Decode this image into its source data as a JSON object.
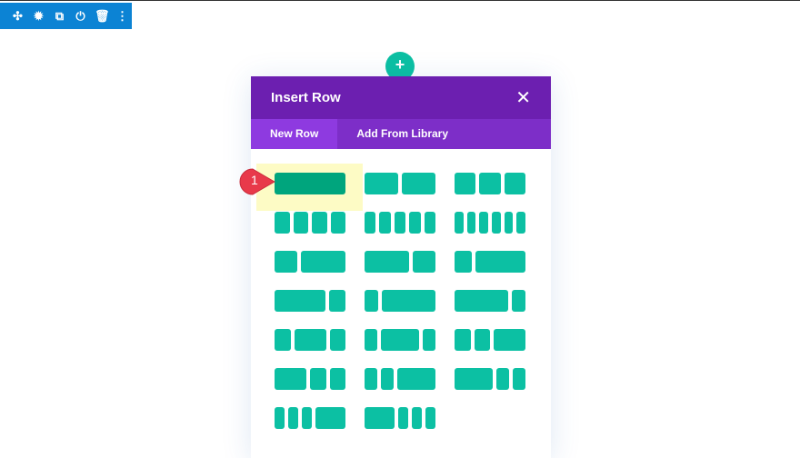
{
  "toolbar": {
    "icons": [
      "move-icon",
      "gear-icon",
      "duplicate-icon",
      "power-icon",
      "trash-icon",
      "more-icon"
    ],
    "glyphs": [
      "✣",
      "✹",
      "⧉",
      "⏻",
      "🗑",
      "⋮"
    ]
  },
  "add_button": {
    "glyph": "+"
  },
  "modal": {
    "title": "Insert Row",
    "close": "✕",
    "tabs": [
      {
        "label": "New Row",
        "active": true
      },
      {
        "label": "Add From Library",
        "active": false
      }
    ]
  },
  "layouts": [
    [
      1
    ],
    [
      1,
      1
    ],
    [
      1,
      1,
      1
    ],
    [
      1,
      1,
      1,
      1
    ],
    [
      1,
      1,
      1,
      1,
      1
    ],
    [
      1,
      1,
      1,
      1,
      1,
      1
    ],
    [
      1,
      2
    ],
    [
      2,
      1
    ],
    [
      1,
      3
    ],
    [
      3,
      1
    ],
    [
      1,
      4
    ],
    [
      4,
      1
    ],
    [
      1,
      2,
      1
    ],
    [
      1,
      3,
      1
    ],
    [
      1,
      1,
      2
    ],
    [
      2,
      1,
      1
    ],
    [
      1,
      1,
      3
    ],
    [
      3,
      1,
      1
    ],
    [
      1,
      1,
      1,
      3
    ],
    [
      3,
      1,
      1,
      1
    ]
  ],
  "selected_layout": 0,
  "annotation": {
    "number": "1",
    "color": "#e8394a"
  },
  "colors": {
    "accent": "#0cc0a3",
    "header": "#6c1fb0",
    "tabs": "#7d2ec8",
    "toolbar": "#0c83d4"
  }
}
